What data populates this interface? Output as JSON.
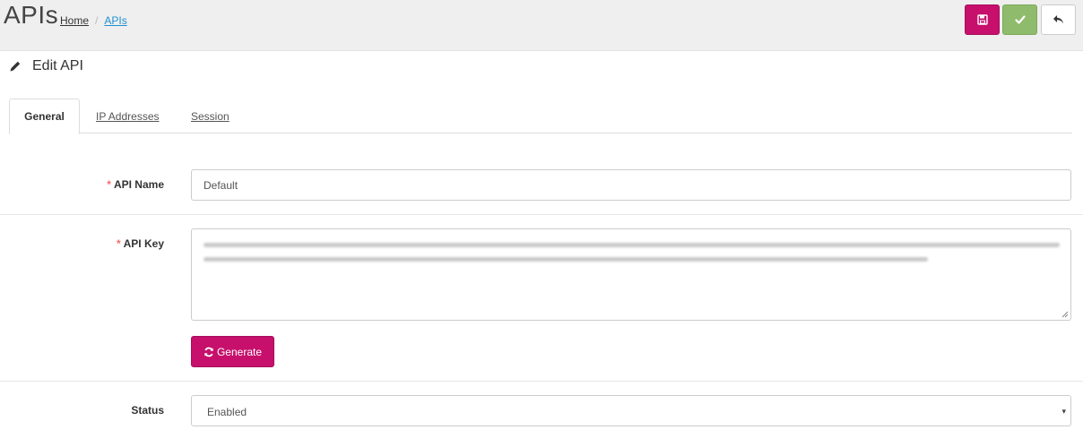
{
  "header": {
    "title": "APIs",
    "breadcrumb": [
      {
        "label": "Home"
      },
      {
        "label": "APIs"
      }
    ],
    "breadcrumb_separator": "/",
    "buttons": {
      "save_icon": "floppy-disk-icon",
      "confirm_icon": "check-icon",
      "back_icon": "reply-arrow-icon"
    }
  },
  "section": {
    "title": "Edit API",
    "icon": "pencil-icon"
  },
  "tabs": [
    {
      "label": "General",
      "active": true
    },
    {
      "label": "IP Addresses",
      "active": false
    },
    {
      "label": "Session",
      "active": false
    }
  ],
  "form": {
    "required_marker": "*",
    "api_name": {
      "label": "API Name",
      "value": "Default"
    },
    "api_key": {
      "label": "API Key",
      "value_hidden": true
    },
    "generate_button": {
      "label": "Generate",
      "icon": "refresh-icon"
    },
    "status": {
      "label": "Status",
      "value": "Enabled",
      "caret": "▾"
    }
  },
  "colors": {
    "primary": "#c6106c",
    "success": "#8fbb6c",
    "required": "#f56b6b",
    "link_active": "#1e91cf"
  }
}
